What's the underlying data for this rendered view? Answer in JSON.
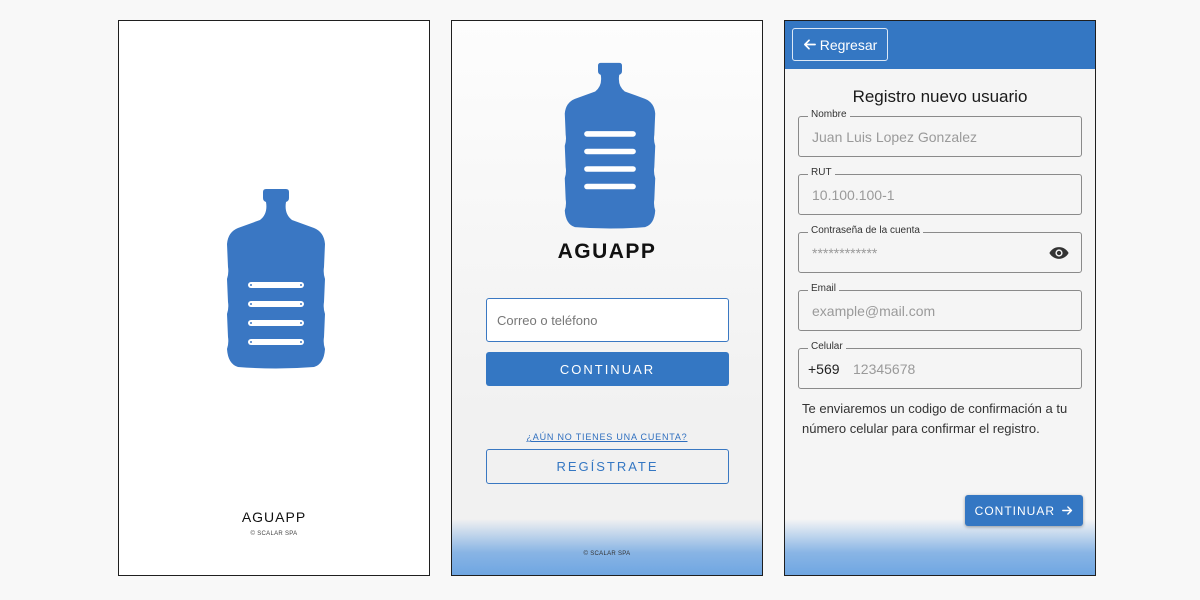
{
  "colors": {
    "brand": "#3477c3",
    "bottle": "#3a77c3",
    "bottom_gradient": "#6fa6e2"
  },
  "splash": {
    "app_name": "AGUAPP",
    "copyright": "© SCALAR SPA"
  },
  "login": {
    "app_name": "AGUAPP",
    "input_placeholder": "Correo o teléfono",
    "continue_label": "CONTINUAR",
    "no_account_link": "¿AÚN NO TIENES UNA CUENTA?",
    "register_label": "REGÍSTRATE",
    "copyright": "© SCALAR SPA"
  },
  "register": {
    "back_icon": "arrow-left-icon",
    "back_label": "Regresar",
    "title": "Registro nuevo usuario",
    "fields": {
      "name": {
        "label": "Nombre",
        "placeholder": "Juan Luis Lopez Gonzalez"
      },
      "rut": {
        "label": "RUT",
        "placeholder": "10.100.100-1"
      },
      "password": {
        "label": "Contraseña de la cuenta",
        "placeholder": "************",
        "icon": "eye-icon"
      },
      "email": {
        "label": "Email",
        "placeholder": "example@mail.com"
      },
      "phone": {
        "label": "Celular",
        "prefix": "+569",
        "placeholder": "12345678"
      }
    },
    "note": "Te enviaremos un codigo de confirmación a tu número celular para confirmar el registro.",
    "continue_label": "CONTINUAR",
    "continue_icon": "arrow-right-icon"
  }
}
